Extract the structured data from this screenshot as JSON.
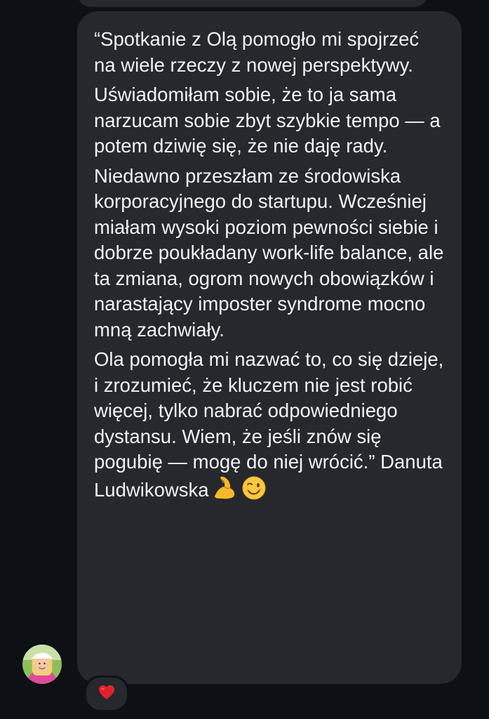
{
  "message": {
    "paragraphs": [
      "“Spotkanie z Olą pomogło mi spojrzeć na wiele rzeczy z nowej perspektywy.",
      "Uświadomiłam sobie, że to ja sama  narzucam sobie zbyt szybkie tempo — a potem dziwię się, że nie daję rady.",
      "Niedawno przeszłam ze środowiska korporacyjnego do startupu. Wcześniej miałam wysoki poziom pewności siebie i dobrze poukładany work-life balance, ale ta zmiana, ogrom nowych obowiązków i narastający imposter syndrome mocno mną zachwiały.",
      "Ola pomogła mi nazwać to, co się dzieje, i zrozumieć, że kluczem nie jest robić więcej, tylko nabrać odpowiedniego dystansu. Wiem, że jeśli znów się pogubię — mogę do niej wrócić.”  Danuta Ludwikowska"
    ],
    "emojis": [
      "flexed-biceps-icon",
      "winking-face-icon"
    ]
  },
  "reaction": {
    "icon": "red-heart-icon",
    "color": "#e5202e"
  },
  "colors": {
    "background": "#0d1014",
    "bubble": "#26282d",
    "text": "#f2f2f3"
  }
}
